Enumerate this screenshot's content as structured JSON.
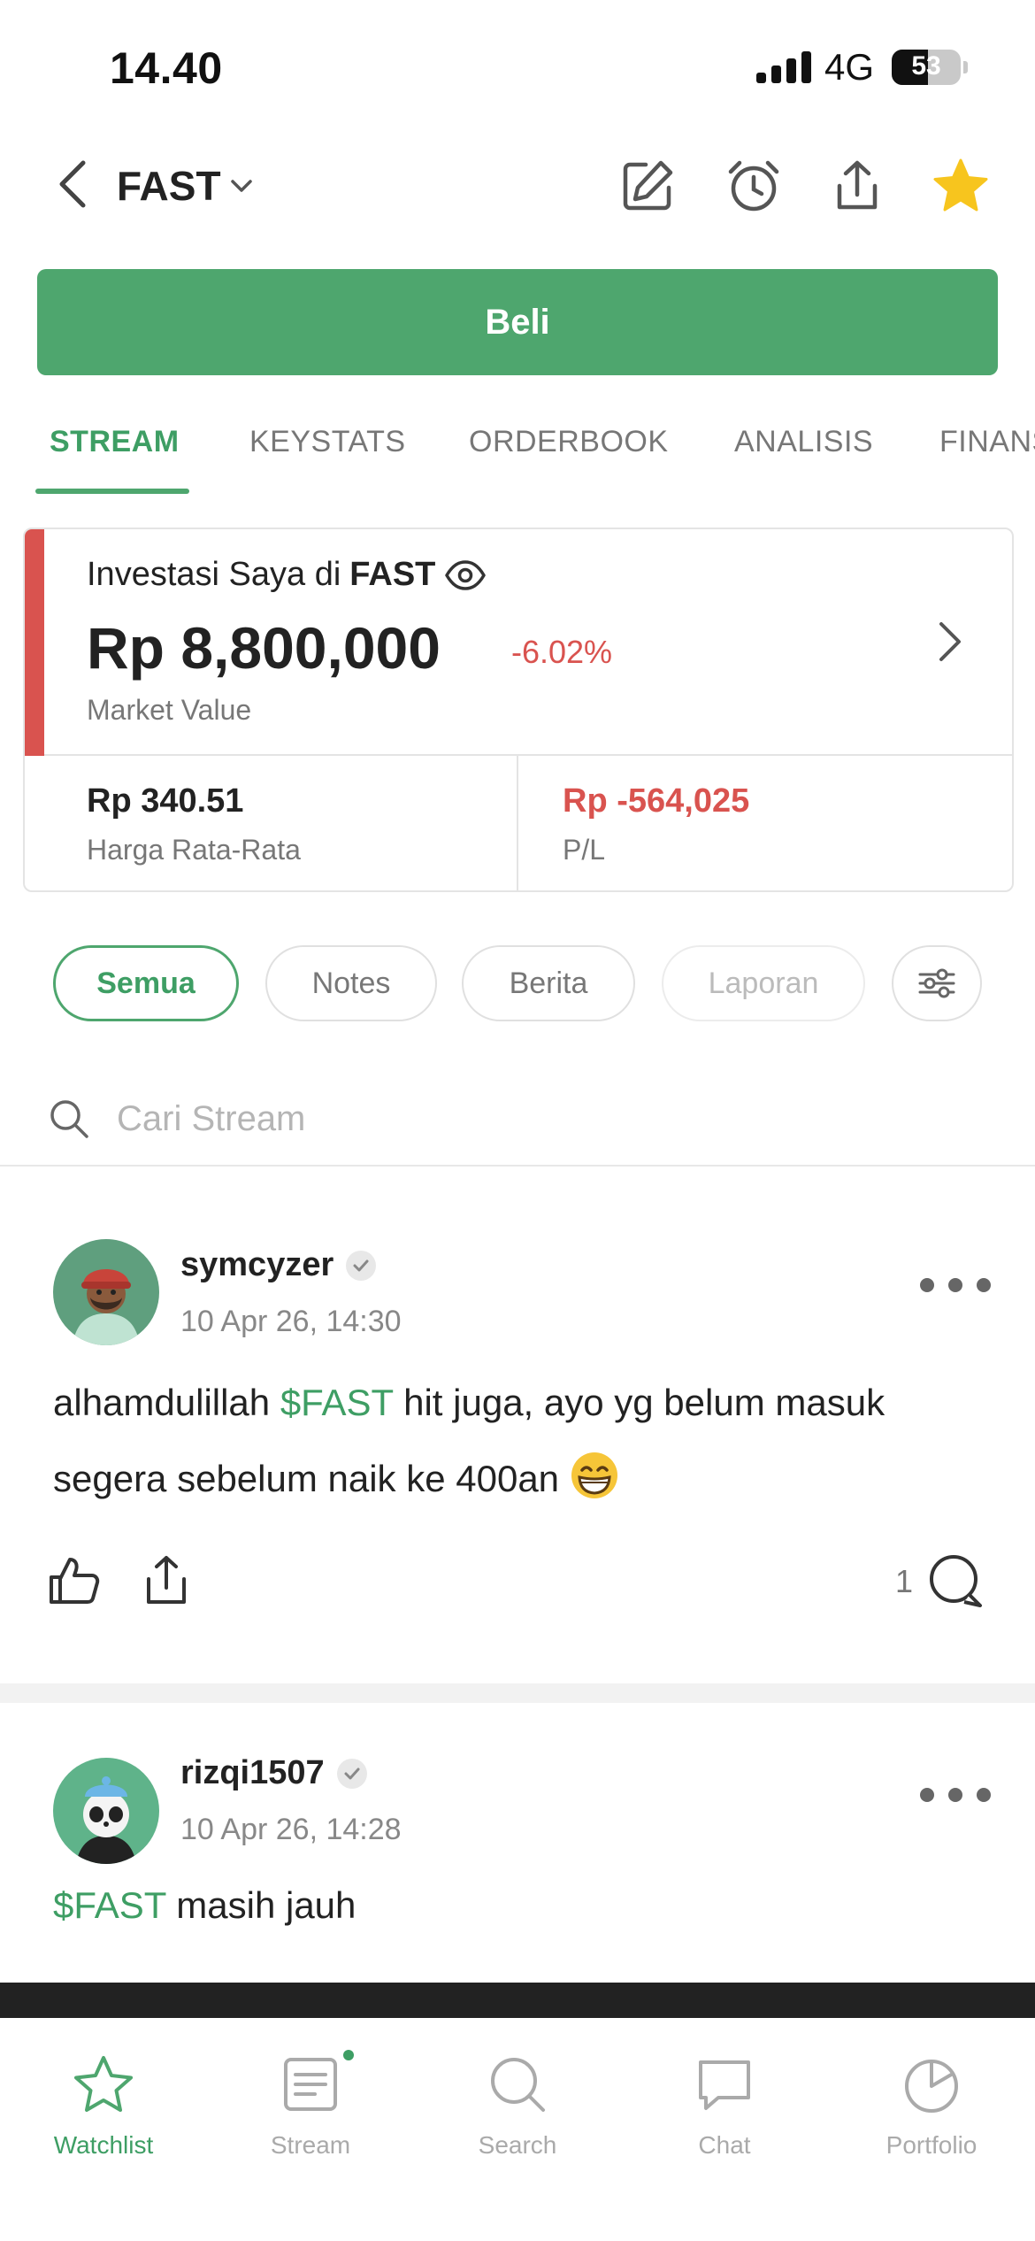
{
  "status_bar": {
    "time": "14.40",
    "network": "4G",
    "battery": "53",
    "battery_level": 0.53
  },
  "header": {
    "ticker": "FAST",
    "icons": [
      "back-icon",
      "chevron-down-icon",
      "edit-icon",
      "alarm-icon",
      "share-icon",
      "star-icon"
    ]
  },
  "buy_button": "Beli",
  "tabs": [
    "STREAM",
    "KEYSTATS",
    "ORDERBOOK",
    "ANALISIS",
    "FINANS"
  ],
  "investment": {
    "title_prefix": "Investasi Saya di",
    "ticker": "FAST",
    "value": "Rp 8,800,000",
    "change": "-6.02%",
    "value_label": "Market Value",
    "avg_price": "Rp 340.51",
    "avg_price_label": "Harga Rata-Rata",
    "pl": "Rp -564,025",
    "pl_label": "P/L"
  },
  "filters": [
    "Semua",
    "Notes",
    "Berita",
    "Laporan"
  ],
  "search": {
    "placeholder": "Cari Stream"
  },
  "posts": [
    {
      "username": "symcyzer",
      "time": "10 Apr 26, 14:30",
      "cashtag": "$FAST",
      "text_before": "alhamdulillah ",
      "text_after": " hit juga, ayo yg belum masuk segera sebelum naik ke 400an",
      "comments": "1"
    },
    {
      "username": "rizqi1507",
      "time": "10 Apr 26, 14:28",
      "cashtag": "$FAST",
      "text_before": "",
      "text_after": " masih jauh"
    }
  ],
  "bottom_nav": [
    {
      "label": "Watchlist",
      "icon": "star-icon",
      "active": true
    },
    {
      "label": "Stream",
      "icon": "stream-icon",
      "active": false
    },
    {
      "label": "Search",
      "icon": "search-icon",
      "active": false
    },
    {
      "label": "Chat",
      "icon": "chat-icon",
      "active": false
    },
    {
      "label": "Portfolio",
      "icon": "pie-chart-icon",
      "active": false
    }
  ],
  "colors": {
    "accent": "#4ea66e",
    "negative": "#d9534f",
    "star": "#f7c51e"
  }
}
